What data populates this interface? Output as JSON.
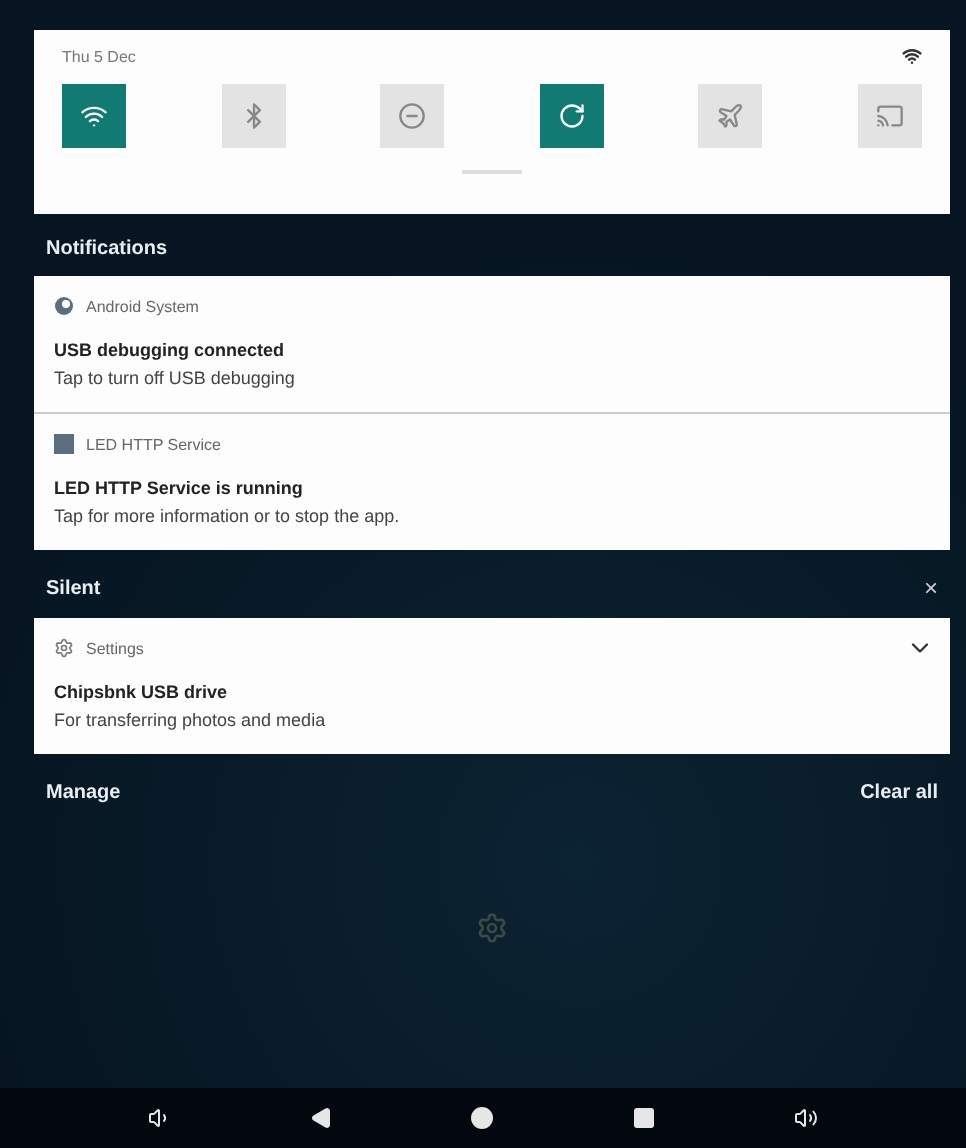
{
  "quick_settings": {
    "date": "Thu 5 Dec",
    "tiles": [
      {
        "kind": "wifi",
        "on": true
      },
      {
        "kind": "bluetooth",
        "on": false
      },
      {
        "kind": "dnd",
        "on": false
      },
      {
        "kind": "rotate",
        "on": true
      },
      {
        "kind": "airplane",
        "on": false
      },
      {
        "kind": "cast",
        "on": false
      }
    ]
  },
  "notifications": {
    "header": "Notifications",
    "items": [
      {
        "app": "Android System",
        "kind": "android",
        "title": "USB debugging connected",
        "text": "Tap to turn off USB debugging"
      },
      {
        "app": "LED HTTP Service",
        "kind": "square",
        "title": "LED HTTP Service is running",
        "text": "Tap for more information or to stop the app."
      }
    ]
  },
  "silent": {
    "header": "Silent",
    "close": "×",
    "items": [
      {
        "app": "Settings",
        "kind": "gear",
        "title": "Chipsbnk USB drive",
        "text": "For transferring photos and media",
        "expanded": false
      }
    ]
  },
  "footer": {
    "manage": "Manage",
    "clear_all": "Clear all"
  },
  "nav_bar": [
    {
      "kind": "volume-down"
    },
    {
      "kind": "back"
    },
    {
      "kind": "home"
    },
    {
      "kind": "recents"
    },
    {
      "kind": "volume-up"
    }
  ]
}
